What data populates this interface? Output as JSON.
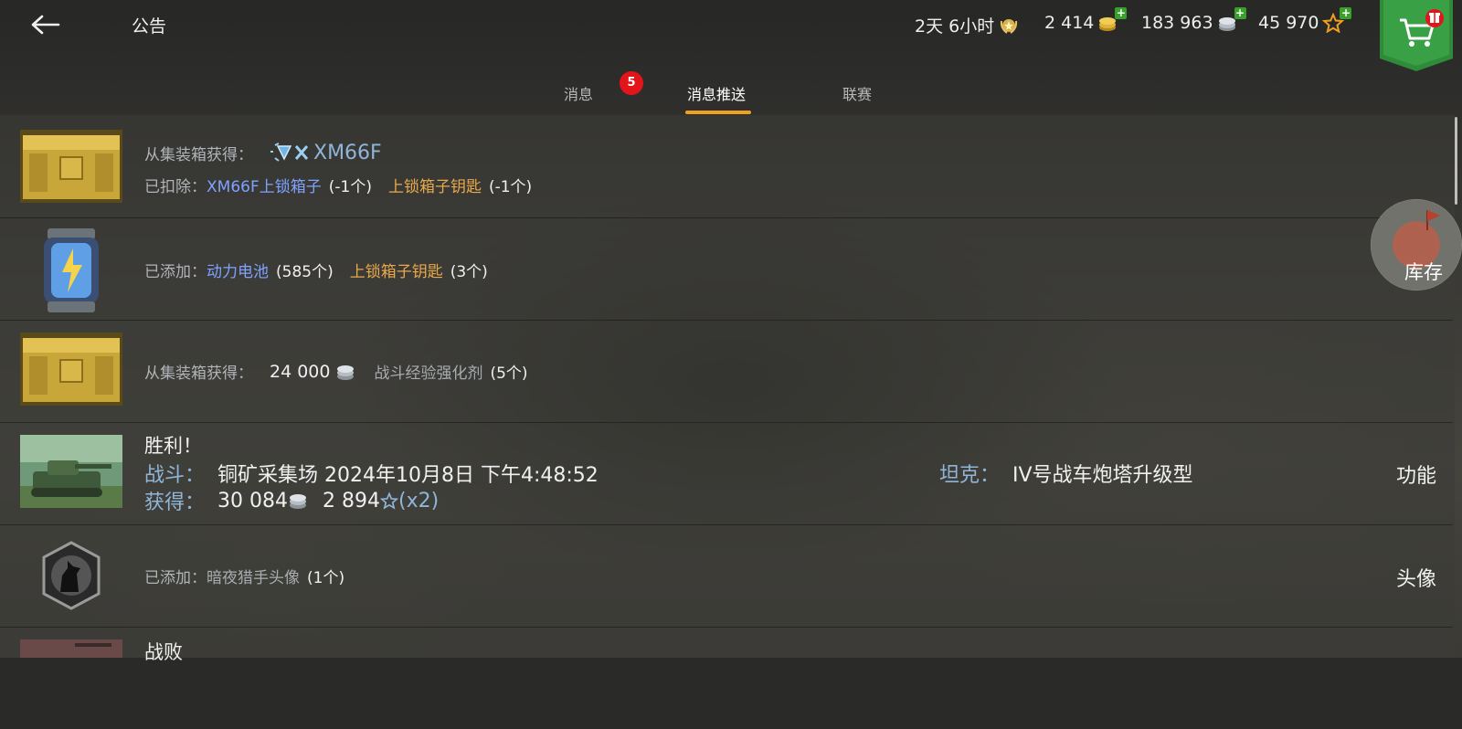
{
  "header": {
    "title": "公告",
    "timer": "2天 6小时",
    "gold": "2 414",
    "silver": "183 963",
    "xp": "45 970"
  },
  "tabs": [
    {
      "label": "消息",
      "badge": "5"
    },
    {
      "label": "消息推送"
    },
    {
      "label": "联赛"
    }
  ],
  "side": {
    "stock_label": "库存"
  },
  "messages": [
    {
      "line1_label": "从集装箱获得：",
      "line1_item": "XM66F",
      "line2_label": "已扣除：",
      "item_a": "XM66F上锁箱子",
      "item_a_qty": "(-1个)",
      "item_b": "上锁箱子钥匙",
      "item_b_qty": "(-1个)"
    },
    {
      "label": "已添加：",
      "item_a": "动力电池",
      "item_a_qty": "(585个)",
      "item_b": "上锁箱子钥匙",
      "item_b_qty": "(3个)"
    },
    {
      "label": "从集装箱获得：",
      "silver": "24 000",
      "item": "战斗经验强化剂",
      "item_qty": "(5个)"
    },
    {
      "title": "胜利！",
      "battle_label": "战斗：",
      "battle_value": "铜矿采集场 2024年10月8日 下午4:48:52",
      "earned_label": "获得：",
      "earned_silver": "30 084",
      "earned_xp": "2 894",
      "xp_mult": "(x2)",
      "tank_label": "坦克：",
      "tank_value": "IV号战车炮塔升级型",
      "action": "功能"
    },
    {
      "label": "已添加：",
      "item": "暗夜猎手头像",
      "item_qty": "(1个)",
      "action": "头像"
    },
    {
      "title": "战败"
    }
  ]
}
